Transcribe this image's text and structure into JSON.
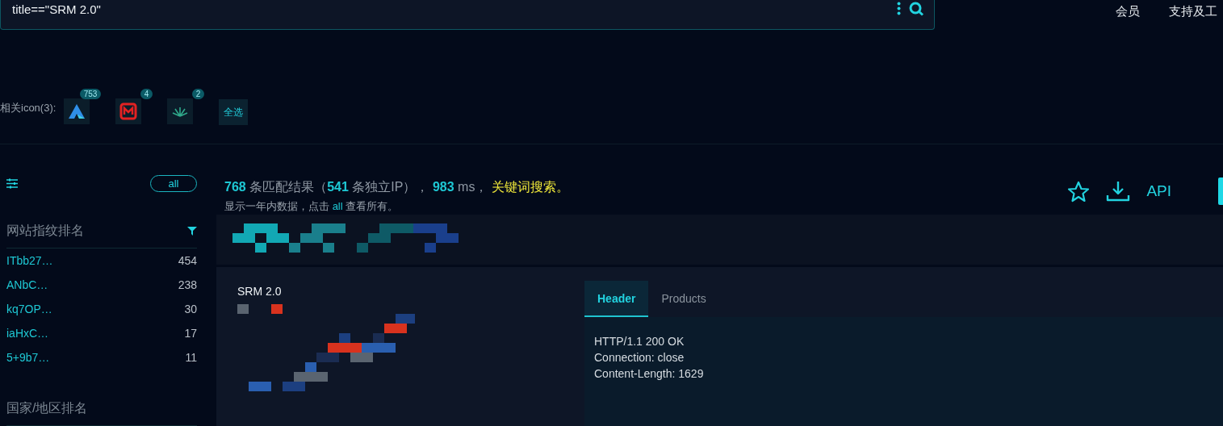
{
  "search": {
    "value": "title==\"SRM 2.0\""
  },
  "nav": [
    "会员",
    "支持及工"
  ],
  "related_icons": {
    "label": "相关icon(3):",
    "items": [
      {
        "kind": "a-logo",
        "count": "753"
      },
      {
        "kind": "m-logo",
        "count": "4"
      },
      {
        "kind": "plant-logo",
        "count": "2"
      }
    ],
    "select_all": "全选"
  },
  "sidebar": {
    "all_button": "all",
    "sections": [
      {
        "title": "网站指纹排名",
        "items": [
          {
            "name": "ITbb27…",
            "count": "454"
          },
          {
            "name": "ANbC…",
            "count": "238"
          },
          {
            "name": "kq7OP…",
            "count": "30"
          },
          {
            "name": "iaHxC…",
            "count": "17"
          },
          {
            "name": "5+9b7…",
            "count": "11"
          }
        ]
      },
      {
        "title": "国家/地区排名"
      }
    ]
  },
  "summary": {
    "total": "768",
    "total_label": "条匹配结果（",
    "ips": "541",
    "ips_label": "条独立IP），",
    "ms": "983",
    "ms_label": "ms，",
    "keyword": "关键词搜索。",
    "note_before": "显示一年内数据，点击",
    "note_link": "all",
    "note_after": "查看所有。"
  },
  "actions": {
    "api": "API"
  },
  "result": {
    "title": "SRM 2.0",
    "tabs": [
      {
        "label": "Header",
        "selected": true
      },
      {
        "label": "Products",
        "selected": false
      }
    ],
    "header_lines": [
      "HTTP/1.1 200 OK",
      "Connection: close",
      "Content-Length: 1629"
    ]
  }
}
